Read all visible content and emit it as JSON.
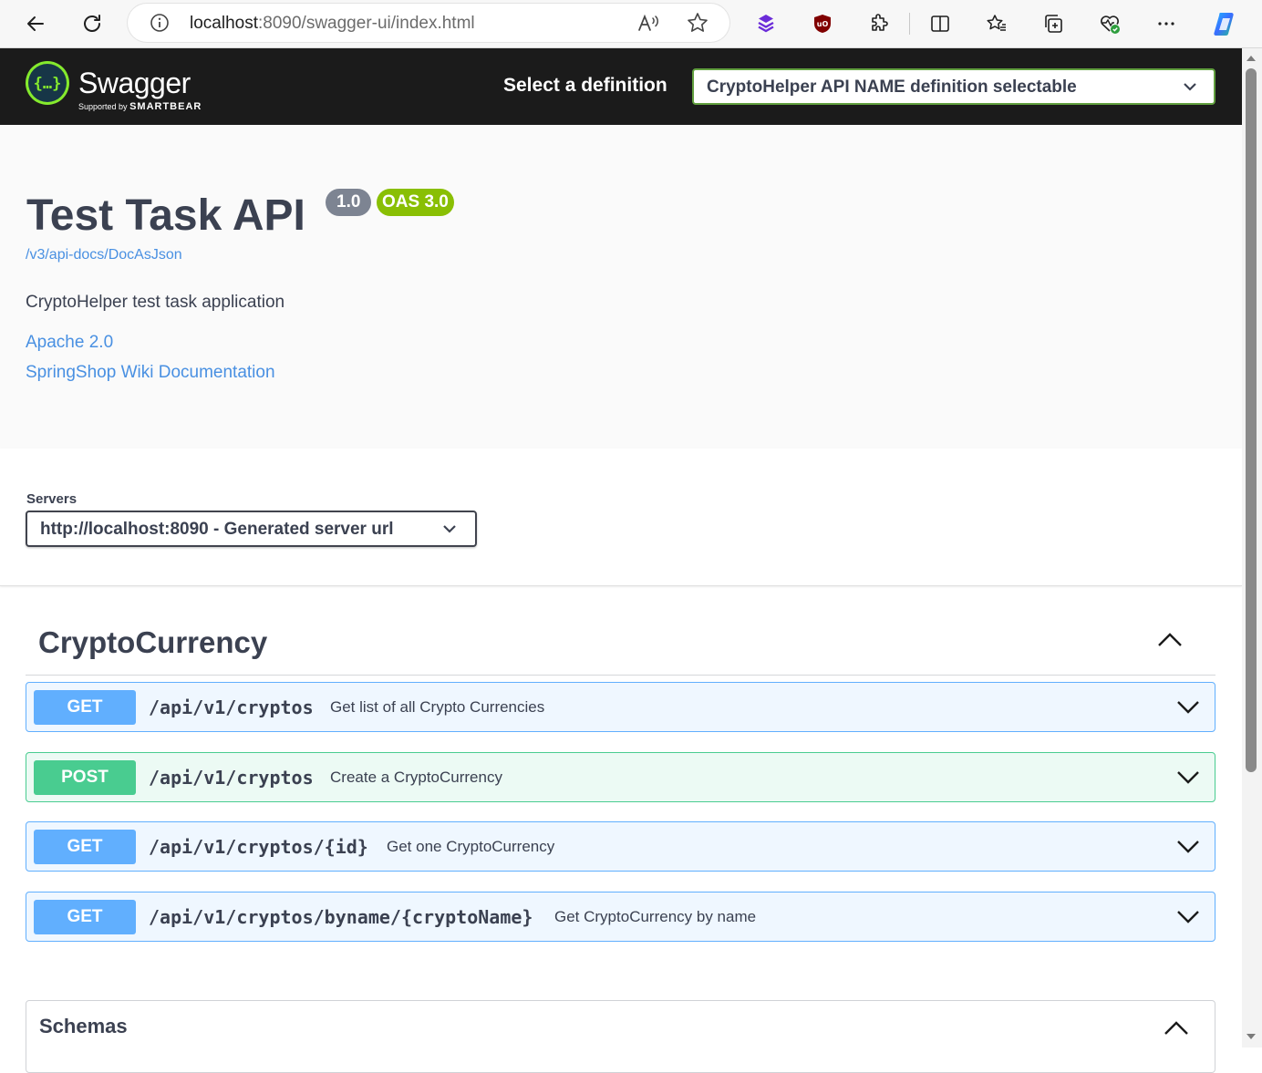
{
  "browser": {
    "url_host": "localhost",
    "url_rest": ":8090/swagger-ui/index.html"
  },
  "topbar": {
    "logo_text": "Swagger",
    "logo_sub_prefix": "Supported by",
    "logo_sub_brand": "SMARTBEAR",
    "definition_label": "Select a definition",
    "definition_value": "CryptoHelper API NAME definition selectable"
  },
  "info": {
    "title": "Test Task API",
    "version": "1.0",
    "oas": "OAS 3.0",
    "doc_link": "/v3/api-docs/DocAsJson",
    "description": "CryptoHelper test task application",
    "license": "Apache 2.0",
    "external_docs": "SpringShop Wiki Documentation"
  },
  "servers": {
    "label": "Servers",
    "selected": "http://localhost:8090 - Generated server url"
  },
  "tag": {
    "name": "CryptoCurrency"
  },
  "operations": [
    {
      "method": "GET",
      "path": "/api/v1/cryptos",
      "summary": "Get list of all Crypto Currencies"
    },
    {
      "method": "POST",
      "path": "/api/v1/cryptos",
      "summary": "Create a CryptoCurrency"
    },
    {
      "method": "GET",
      "path": "/api/v1/cryptos/{id}",
      "summary": "Get one CryptoCurrency"
    },
    {
      "method": "GET",
      "path": "/api/v1/cryptos/byname/{cryptoName}",
      "summary": "Get CryptoCurrency by name"
    }
  ],
  "schemas": {
    "label": "Schemas"
  },
  "colors": {
    "get": "#61affe",
    "post": "#49cc90",
    "topbar": "#1b1b1b",
    "link": "#4990e2"
  }
}
